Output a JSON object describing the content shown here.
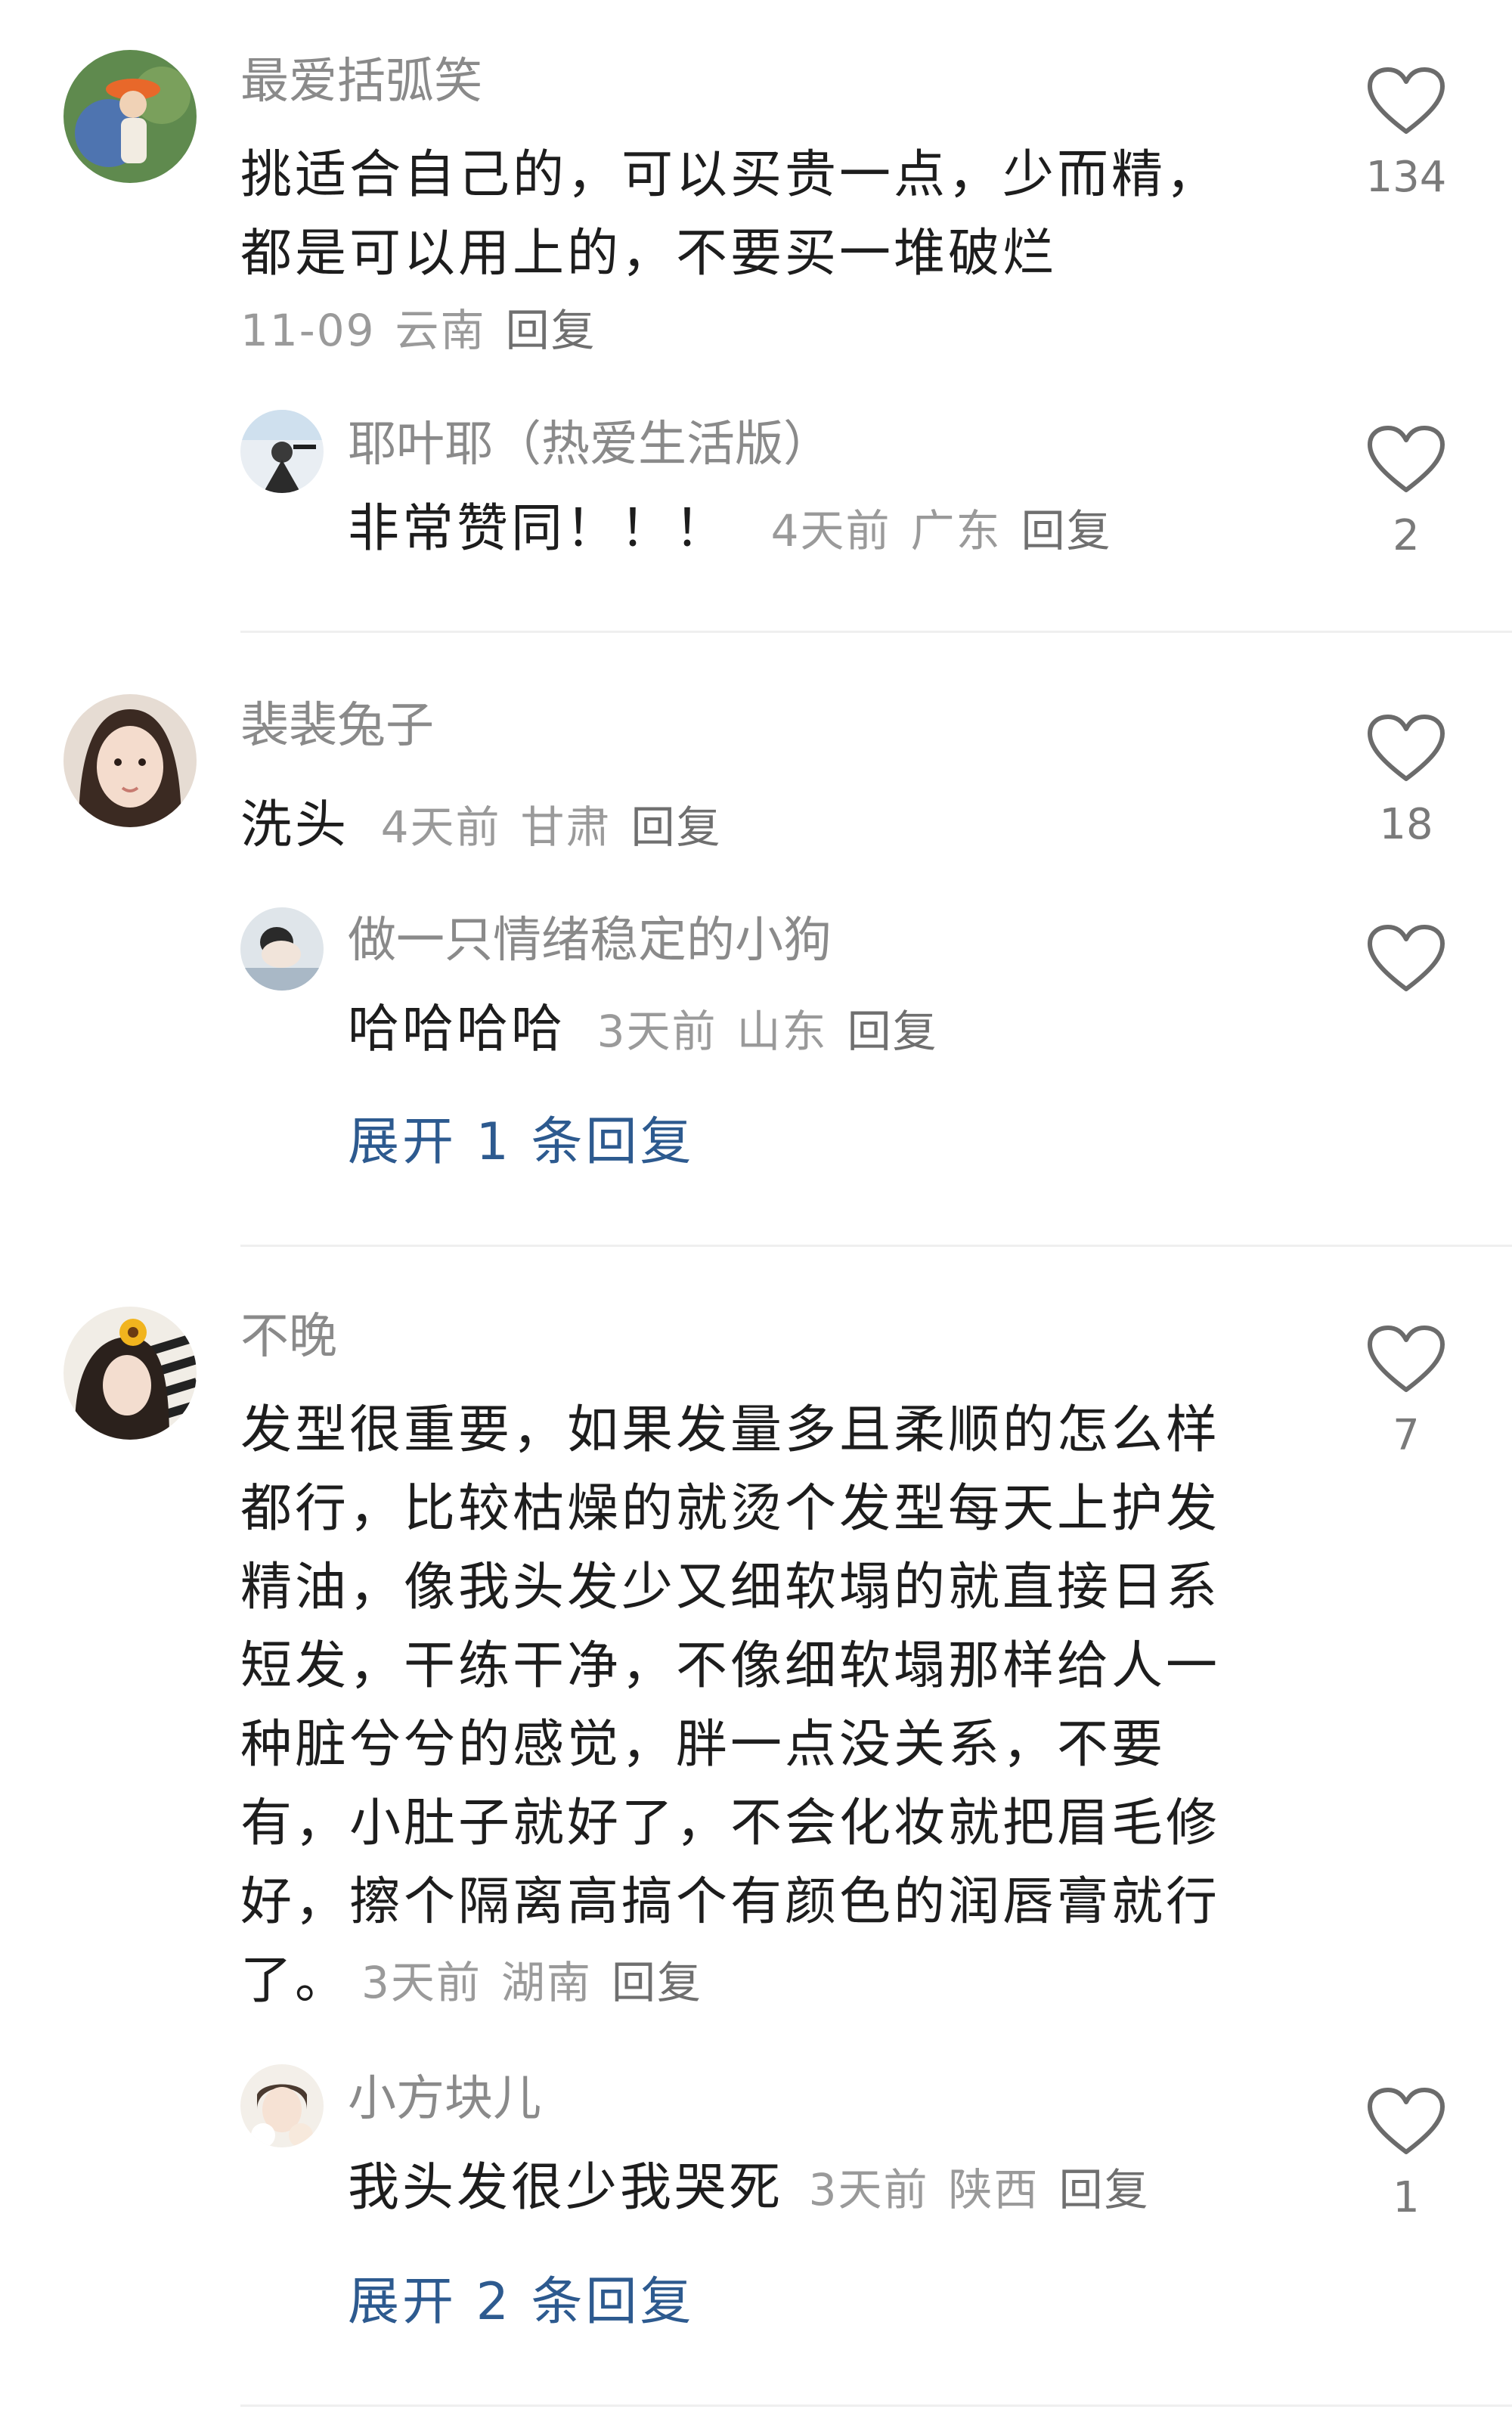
{
  "comments": [
    {
      "username": "最爱括弧笑",
      "text": "挑适合自己的，可以买贵一点，少而精，都是可以用上的，不要买一堆破烂",
      "time": "11-09",
      "location": "云南",
      "reply_label": "回复",
      "likes": "134",
      "replies": [
        {
          "username": "耶叶耶（热爱生活版）",
          "text": "非常赞同！！！",
          "time": "4天前",
          "location": "广东",
          "reply_label": "回复",
          "likes": "2"
        }
      ]
    },
    {
      "username": "裴裴兔子",
      "text": "洗头",
      "time": "4天前",
      "location": "甘肃",
      "reply_label": "回复",
      "likes": "18",
      "replies": [
        {
          "username": "做一只情绪稳定的小狗",
          "text": "哈哈哈哈",
          "time": "3天前",
          "location": "山东",
          "reply_label": "回复",
          "likes": ""
        }
      ],
      "expand_label": "展开 1 条回复"
    },
    {
      "username": "不晚",
      "text": "发型很重要，如果发量多且柔顺的怎么样都行，比较枯燥的就烫个发型每天上护发精油，像我头发少又细软塌的就直接日系短发，干练干净，不像细软塌那样给人一种脏兮兮的感觉，胖一点没关系，不要有，小肚子就好了，不会化妆就把眉毛修好，擦个隔离高搞个有颜色的润唇膏就行了。",
      "time": "3天前",
      "location": "湖南",
      "reply_label": "回复",
      "likes": "7",
      "replies": [
        {
          "username": "小方块儿",
          "text": "我头发很少我哭死",
          "time": "3天前",
          "location": "陕西",
          "reply_label": "回复",
          "likes": "1"
        }
      ],
      "expand_label": "展开 2 条回复"
    }
  ],
  "colors": {
    "link": "#2d5a8f",
    "username": "#8a8a8a",
    "body": "#1d1d1d",
    "meta": "#9a9a9a"
  }
}
